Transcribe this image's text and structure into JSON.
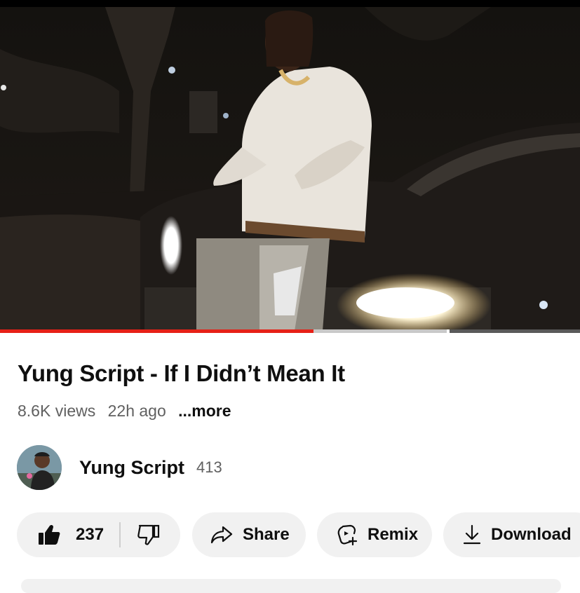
{
  "video": {
    "title": "Yung Script - If I Didn’t Mean It",
    "views": "8.6K views",
    "age": "22h ago",
    "more_label": "...more",
    "progress": {
      "played_fraction": 0.54,
      "buffered_fraction": 0.77
    }
  },
  "channel": {
    "name": "Yung Script",
    "subscribers": "413"
  },
  "actions": {
    "like_count": "237",
    "share_label": "Share",
    "remix_label": "Remix",
    "download_label": "Download"
  },
  "icons": {
    "like": "thumbs-up-icon",
    "dislike": "thumbs-down-icon",
    "share": "share-arrow-icon",
    "remix": "remix-icon",
    "download": "download-icon"
  },
  "colors": {
    "progress_played": "#e62117",
    "pill_background": "#f1f1f1",
    "secondary_text": "#606060"
  }
}
